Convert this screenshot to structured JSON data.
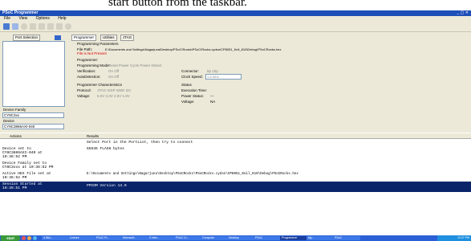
{
  "caption": "start button from the taskbar.",
  "window": {
    "title": "PSoC Programmer",
    "controls": "_ ▢ ✕"
  },
  "menu": [
    "File",
    "View",
    "Options",
    "Help"
  ],
  "left": {
    "port_tab": "Port Selection",
    "device_family_label": "Device Family",
    "device_family_value": "CY8C3xx",
    "device_label": "Device",
    "device_value": "CY8C3866AXI-040"
  },
  "tabs": [
    "Programmer",
    "Utilities",
    "JTAG"
  ],
  "params": {
    "section": "Programming Parameters",
    "file_path_label": "File Path:",
    "file_path_value": "E:\\Documents and Settings\\Nagarjuna\\Desktop\\PSoC\\Rocks\\PSoC\\Rocks.cydsn\\CP8051_Keil_810\\Debug\\PSoCRocks.hex",
    "file_status": "File is Not Present",
    "programmer_label": "Programmer:",
    "programming_mode_label": "Programming Mode:",
    "programming_mode_options": "Reset  Power Cycle  Power Detect",
    "verification_label": "Verification:",
    "verification_options": "On  Off",
    "autodetection_label": "AutoDetection:",
    "autodetection_options": "On  Off",
    "connector_label": "Connector:",
    "connector_options": "5p  10p",
    "clock_speed_label": "Clock Speed:",
    "clock_speed_value": "1.6 MHz"
  },
  "characteristics": {
    "section": "Programmer Characteristics",
    "protocol_label": "Protocol:",
    "protocol_options": "JTAG  ISSP  SWD  I2C",
    "voltage_label": "Voltage:",
    "voltage_options": "5.0V  3.3V  2.5V  1.8V",
    "status_section": "Status",
    "execution_time_label": "Execution Time:",
    "power_status_label": "Power Status:",
    "power_status_value": "---",
    "voltage_status_label": "Voltage:",
    "voltage_status_value": "NA"
  },
  "log": {
    "actions_header": "Actions",
    "results_header": "Results",
    "rows": [
      {
        "action": "",
        "result": "Select Port in the PortList, then try to connect"
      },
      {
        "action": "Device set to\nCY8C3866AXI-040 at\n10:36:52 PM",
        "result": "65536 FLASH bytes"
      },
      {
        "action": "Device Family set to\nCY8C3xxx at 10:36:52 PM",
        "result": ""
      },
      {
        "action": "Active HEX File set at\n10:36:52 PM",
        "result": "E:\\Documents and Settings\\Nagarjuna\\Desktop\\PSoCRocks\\PSoCRocks.cydsn\\CP8051_Keil_810\\Debug\\PSoCRocks.hex"
      },
      {
        "action": "Session Started at\n10:36:51 PM",
        "result": "PPCOM Version 13.0"
      }
    ]
  },
  "taskbar": {
    "start": "start",
    "items": [
      "4 Win...",
      "Lecture",
      "PSoC Pr...",
      "Microsoft...",
      "3 Inter...",
      "PSoC Cr...",
      "Computer",
      "Desktop",
      "PSoC",
      "Programmer",
      "My...",
      "PSoC"
    ],
    "clock": "10:37 PM"
  },
  "colors": {
    "title": "#1d4fb8",
    "panel": "#ece9d8",
    "highlight": "#0a246a"
  }
}
